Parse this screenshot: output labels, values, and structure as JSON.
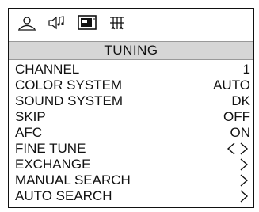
{
  "icons": [
    "picture-icon",
    "sound-icon",
    "tv-screen-icon",
    "tuning-icon"
  ],
  "menu": {
    "title": "TUNING",
    "items": [
      {
        "label": "CHANNEL",
        "value": "1"
      },
      {
        "label": "COLOR SYSTEM",
        "value": "AUTO"
      },
      {
        "label": "SOUND SYSTEM",
        "value": "DK"
      },
      {
        "label": "SKIP",
        "value": "OFF"
      },
      {
        "label": "AFC",
        "value": "ON"
      },
      {
        "label": "FINE TUNE",
        "value": ""
      },
      {
        "label": "EXCHANGE",
        "value": ""
      },
      {
        "label": "MANUAL SEARCH",
        "value": ""
      },
      {
        "label": "AUTO SEARCH",
        "value": ""
      }
    ]
  }
}
